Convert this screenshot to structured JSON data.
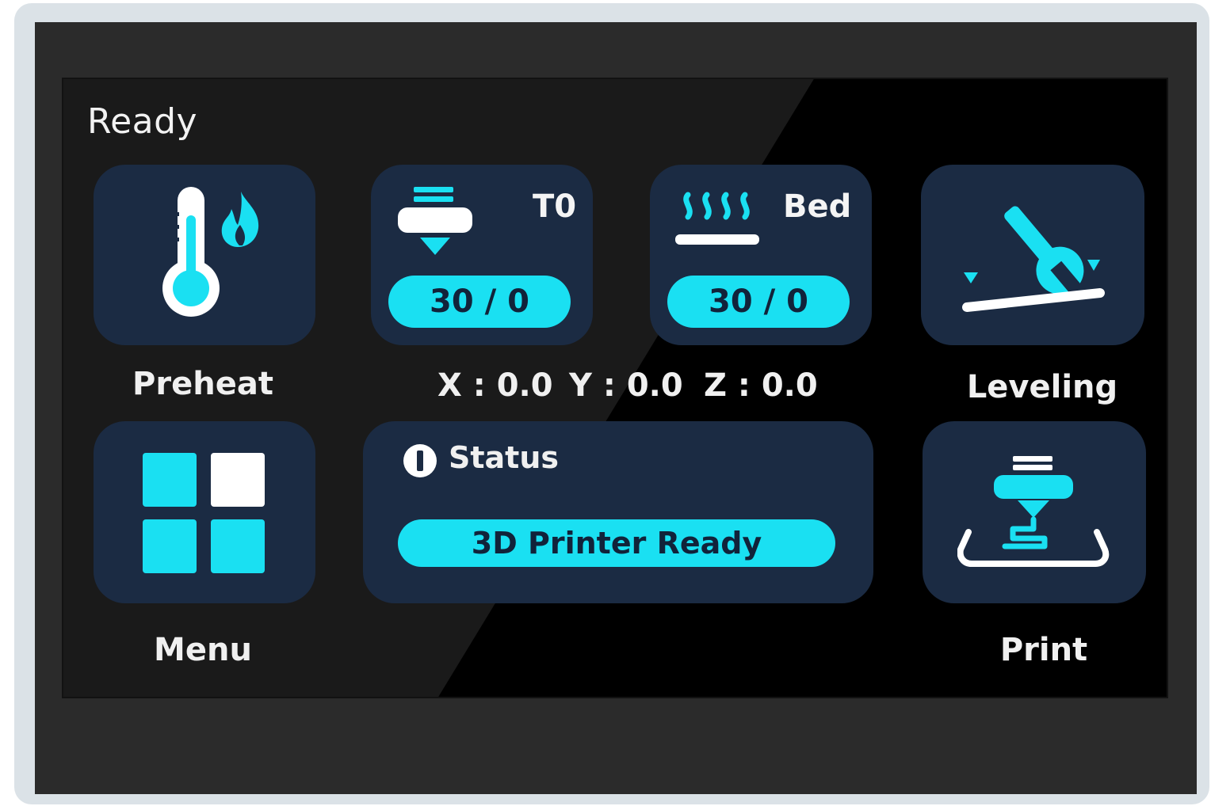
{
  "screen": {
    "title": "Ready"
  },
  "preheat": {
    "label": "Preheat",
    "icon": "thermometer-flame-icon"
  },
  "nozzle": {
    "label": "T0",
    "value": "30 / 0",
    "icon": "nozzle-icon"
  },
  "bed": {
    "label": "Bed",
    "value": "30 / 0",
    "icon": "heated-bed-icon"
  },
  "leveling": {
    "label": "Leveling",
    "icon": "wrench-level-icon"
  },
  "coordinates": {
    "x": "X : 0.0",
    "y": "Y : 0.0",
    "z": "Z : 0.0"
  },
  "menu": {
    "label": "Menu",
    "icon": "grid-menu-icon"
  },
  "status": {
    "title": "Status",
    "message": "3D Printer Ready",
    "icon": "info-icon"
  },
  "print": {
    "label": "Print",
    "icon": "print-nozzle-icon"
  },
  "colors": {
    "accent": "#1ae0f2",
    "tile": "#1b2b43",
    "screen": "#000000",
    "bezel": "#2b2b2b",
    "frame": "#dbe2e7"
  }
}
